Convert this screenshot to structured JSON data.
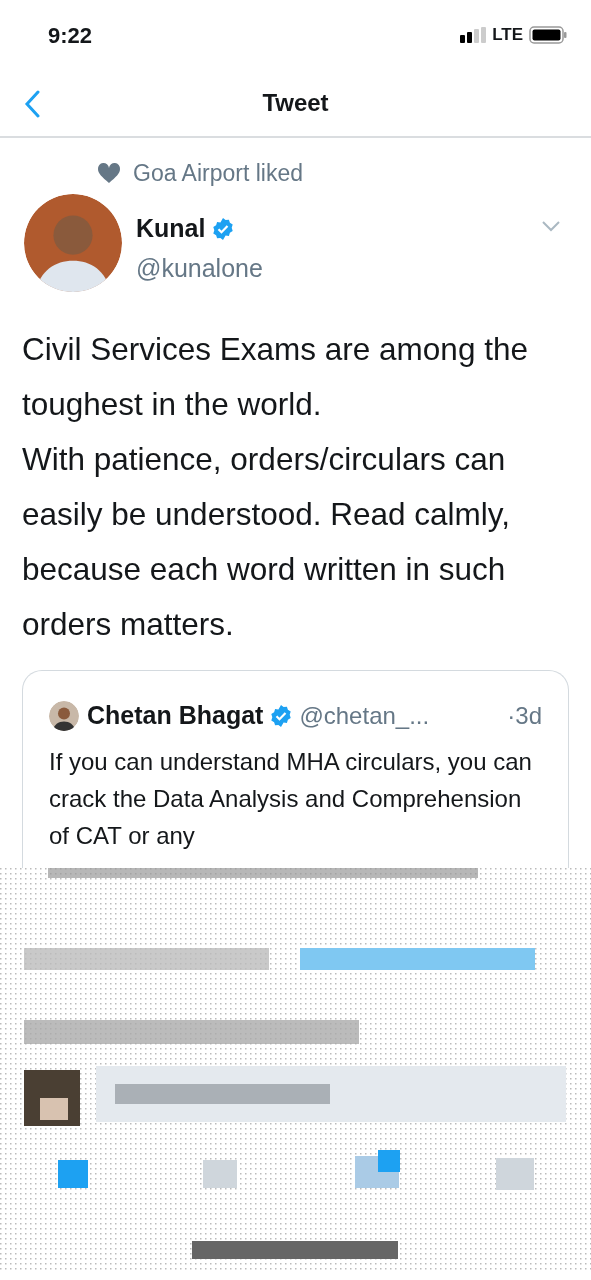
{
  "status_bar": {
    "time": "9:22",
    "network": "LTE"
  },
  "nav": {
    "title": "Tweet"
  },
  "social_context": {
    "text": "Goa Airport liked"
  },
  "tweet": {
    "name": "Kunal",
    "verified": true,
    "handle": "@kunalone",
    "text": "Civil Services Exams are among the toughest in the world.\nWith patience, orders/circulars can easily be understood. Read calmly, because each word written in such orders matters."
  },
  "quoted_tweet": {
    "name": "Chetan Bhagat",
    "verified": true,
    "handle": "@chetan_...",
    "time": "·3d",
    "text": "If you can understand MHA circulars, you can crack the Data Analysis and Comprehension of  CAT or any"
  }
}
